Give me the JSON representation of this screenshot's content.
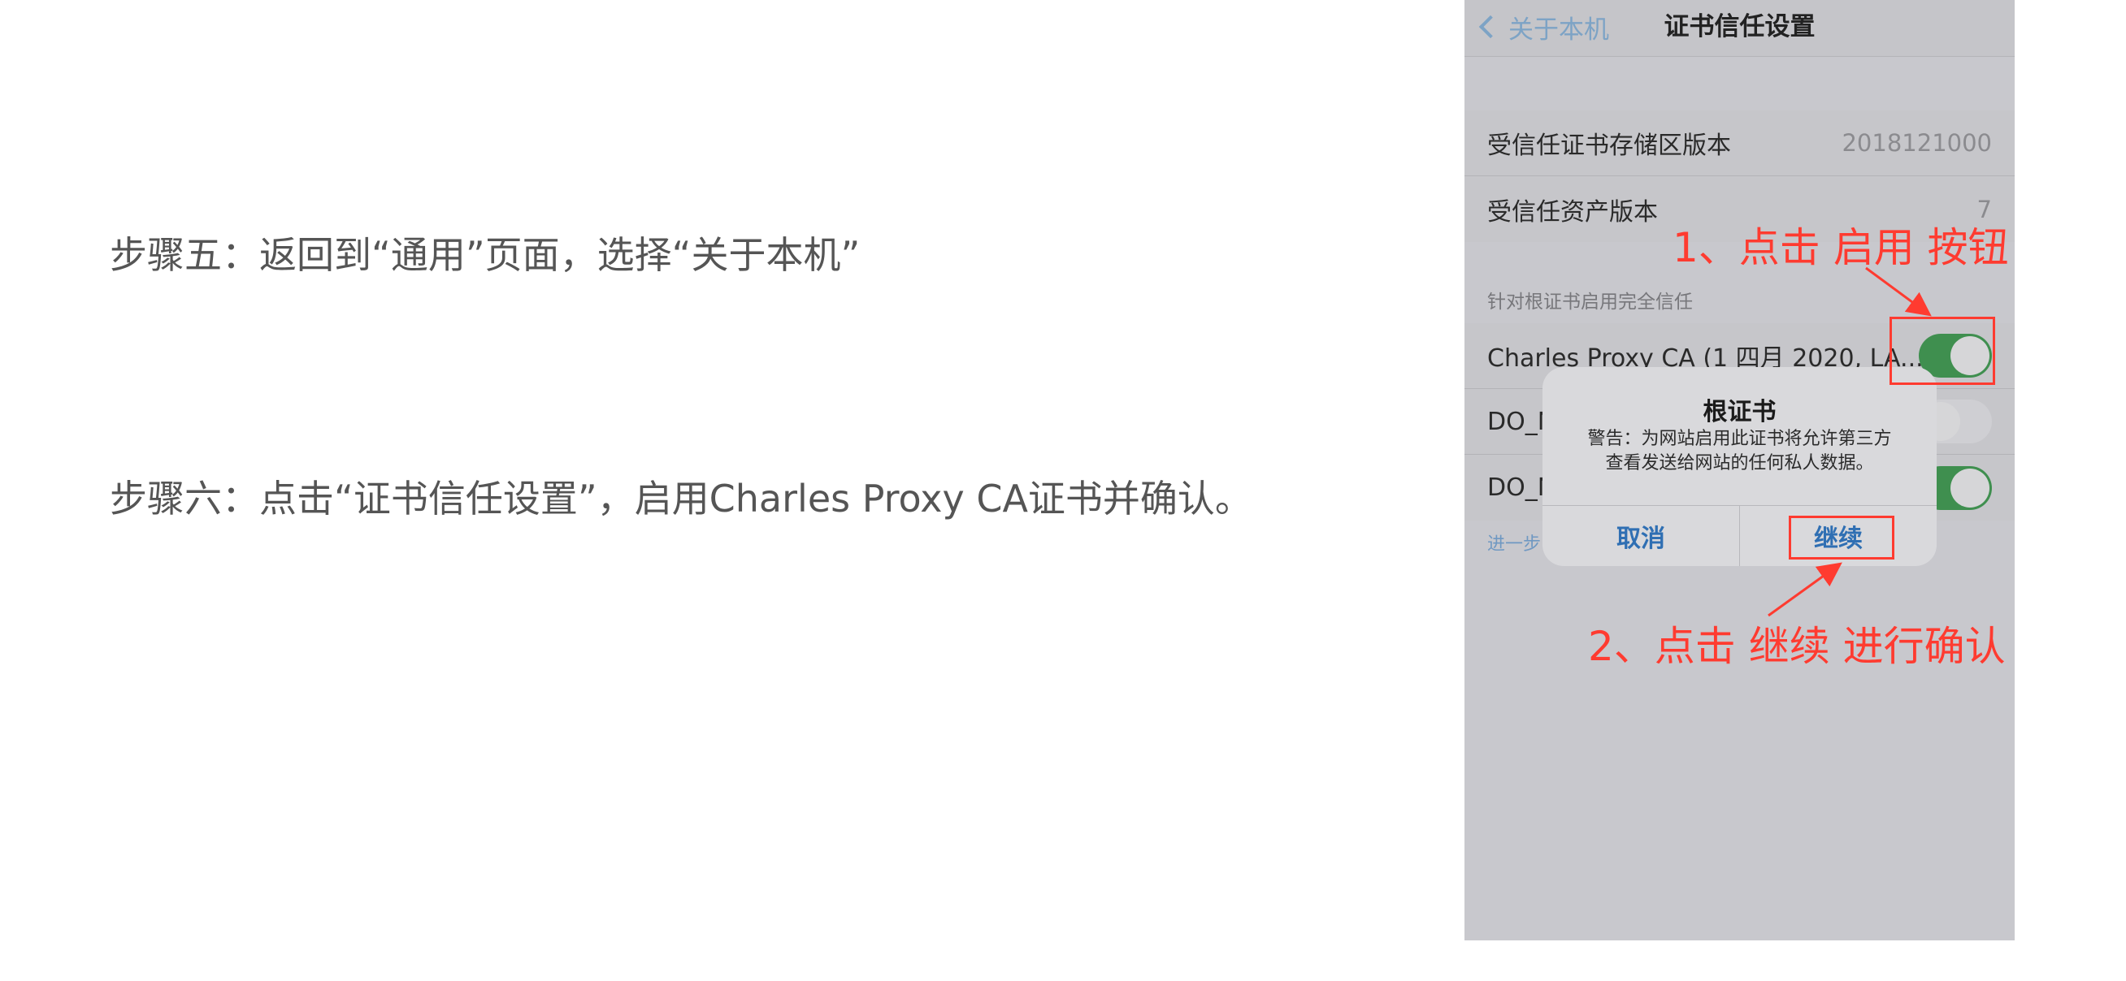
{
  "steps": {
    "step5": "步骤五：返回到“通用”页面，选择“关于本机”",
    "step6": "步骤六：点击“证书信任设置”，启用Charles Proxy CA证书并确认。"
  },
  "phone": {
    "nav": {
      "back_label": "关于本机",
      "title": "证书信任设置"
    },
    "versions": [
      {
        "label": "受信任证书存储区版本",
        "value": "2018121000"
      },
      {
        "label": "受信任资产版本",
        "value": "7"
      }
    ],
    "section_header": "针对根证书启用完全信任",
    "certs": [
      {
        "label": "Charles Proxy CA (1 四月 2020, LA...",
        "enabled": true
      },
      {
        "label": "DO_N",
        "enabled": false
      },
      {
        "label": "DO_N",
        "enabled": true
      }
    ],
    "footer_link": "进一步"
  },
  "alert": {
    "title": "根证书",
    "message_line1": "警告：为网站启用此证书将允许第三方",
    "message_line2": "查看发送给网站的任何私人数据。",
    "cancel_label": "取消",
    "continue_label": "继续"
  },
  "annotations": {
    "note1": "1、点击 启用 按钮",
    "note2": "2、点击 继续 进行确认"
  },
  "colors": {
    "annotation_red": "#ff3b30",
    "toggle_on": "#3f8f4f",
    "ios_blue": "#2f6fb3"
  }
}
